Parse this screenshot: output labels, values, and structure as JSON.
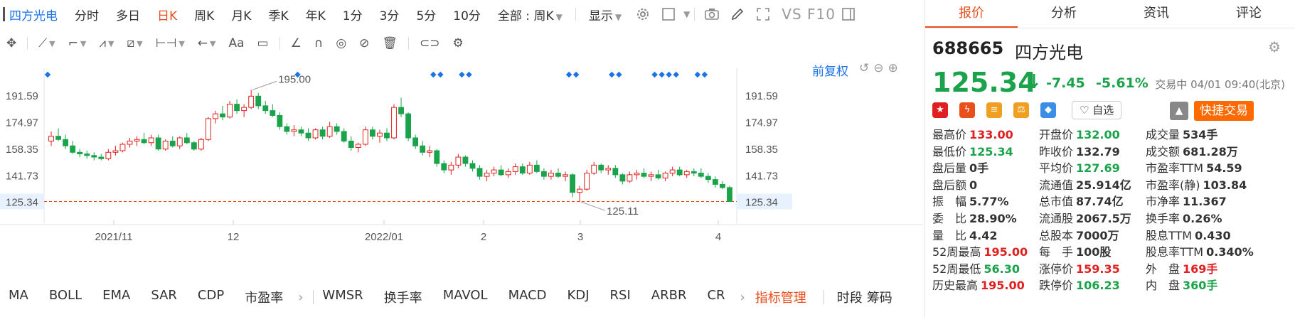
{
  "toolbar": {
    "stock_name": "四方光电",
    "periods": [
      "分时",
      "多日",
      "日K",
      "周K",
      "月K",
      "季K",
      "年K",
      "1分",
      "3分",
      "5分",
      "10分"
    ],
    "active_period": "日K",
    "range_selector": "全部 : 周K",
    "display_label": "显示",
    "vs_label": "VS",
    "f10_label": "F10"
  },
  "drawing_tools": {
    "text_tool": "Aa"
  },
  "chart_controls": {
    "adjust_label": "前复权"
  },
  "chart_data": {
    "type": "candlestick",
    "title": "",
    "x_tick_labels": [
      "2021/11",
      "12",
      "2022/01",
      "2",
      "3",
      "4"
    ],
    "y_tick_labels": [
      "191.59",
      "174.97",
      "158.35",
      "141.73",
      "125.34"
    ],
    "ylim": [
      118,
      204
    ],
    "current_price_line": 125.34,
    "high_annotation": "195.00",
    "low_annotation": "125.11",
    "ohlc_note": "approximate daily candles, values in CNY",
    "candles": [
      {
        "o": 163,
        "h": 169,
        "l": 160,
        "c": 166
      },
      {
        "o": 166,
        "h": 171,
        "l": 163,
        "c": 164
      },
      {
        "o": 164,
        "h": 167,
        "l": 158,
        "c": 160
      },
      {
        "o": 160,
        "h": 163,
        "l": 155,
        "c": 156
      },
      {
        "o": 156,
        "h": 158,
        "l": 153,
        "c": 155
      },
      {
        "o": 155,
        "h": 157,
        "l": 152,
        "c": 154
      },
      {
        "o": 154,
        "h": 156,
        "l": 151,
        "c": 153
      },
      {
        "o": 153,
        "h": 155,
        "l": 151,
        "c": 152
      },
      {
        "o": 152,
        "h": 158,
        "l": 151,
        "c": 156
      },
      {
        "o": 156,
        "h": 160,
        "l": 154,
        "c": 157
      },
      {
        "o": 157,
        "h": 162,
        "l": 156,
        "c": 161
      },
      {
        "o": 161,
        "h": 165,
        "l": 159,
        "c": 163
      },
      {
        "o": 163,
        "h": 166,
        "l": 160,
        "c": 164
      },
      {
        "o": 164,
        "h": 168,
        "l": 161,
        "c": 162
      },
      {
        "o": 162,
        "h": 167,
        "l": 160,
        "c": 165
      },
      {
        "o": 165,
        "h": 167,
        "l": 157,
        "c": 158
      },
      {
        "o": 158,
        "h": 164,
        "l": 157,
        "c": 163
      },
      {
        "o": 163,
        "h": 166,
        "l": 159,
        "c": 160
      },
      {
        "o": 160,
        "h": 166,
        "l": 158,
        "c": 165
      },
      {
        "o": 165,
        "h": 168,
        "l": 161,
        "c": 162
      },
      {
        "o": 162,
        "h": 163,
        "l": 157,
        "c": 158
      },
      {
        "o": 158,
        "h": 165,
        "l": 157,
        "c": 164
      },
      {
        "o": 164,
        "h": 178,
        "l": 163,
        "c": 177
      },
      {
        "o": 177,
        "h": 182,
        "l": 174,
        "c": 180
      },
      {
        "o": 180,
        "h": 185,
        "l": 176,
        "c": 178
      },
      {
        "o": 178,
        "h": 188,
        "l": 177,
        "c": 186
      },
      {
        "o": 186,
        "h": 189,
        "l": 180,
        "c": 182
      },
      {
        "o": 182,
        "h": 186,
        "l": 178,
        "c": 184
      },
      {
        "o": 184,
        "h": 195,
        "l": 183,
        "c": 191
      },
      {
        "o": 191,
        "h": 193,
        "l": 183,
        "c": 185
      },
      {
        "o": 185,
        "h": 188,
        "l": 180,
        "c": 182
      },
      {
        "o": 182,
        "h": 186,
        "l": 178,
        "c": 179
      },
      {
        "o": 179,
        "h": 181,
        "l": 170,
        "c": 172
      },
      {
        "o": 172,
        "h": 174,
        "l": 167,
        "c": 169
      },
      {
        "o": 169,
        "h": 173,
        "l": 166,
        "c": 170
      },
      {
        "o": 170,
        "h": 172,
        "l": 166,
        "c": 168
      },
      {
        "o": 168,
        "h": 171,
        "l": 163,
        "c": 165
      },
      {
        "o": 165,
        "h": 171,
        "l": 164,
        "c": 170
      },
      {
        "o": 170,
        "h": 172,
        "l": 164,
        "c": 166
      },
      {
        "o": 166,
        "h": 175,
        "l": 165,
        "c": 172
      },
      {
        "o": 172,
        "h": 174,
        "l": 167,
        "c": 169
      },
      {
        "o": 169,
        "h": 171,
        "l": 162,
        "c": 163
      },
      {
        "o": 163,
        "h": 166,
        "l": 157,
        "c": 159
      },
      {
        "o": 159,
        "h": 162,
        "l": 156,
        "c": 161
      },
      {
        "o": 161,
        "h": 172,
        "l": 160,
        "c": 170
      },
      {
        "o": 170,
        "h": 172,
        "l": 164,
        "c": 166
      },
      {
        "o": 166,
        "h": 170,
        "l": 162,
        "c": 168
      },
      {
        "o": 168,
        "h": 171,
        "l": 163,
        "c": 165
      },
      {
        "o": 165,
        "h": 186,
        "l": 164,
        "c": 184
      },
      {
        "o": 184,
        "h": 190,
        "l": 178,
        "c": 180
      },
      {
        "o": 180,
        "h": 181,
        "l": 163,
        "c": 165
      },
      {
        "o": 165,
        "h": 167,
        "l": 158,
        "c": 160
      },
      {
        "o": 160,
        "h": 163,
        "l": 154,
        "c": 156
      },
      {
        "o": 156,
        "h": 160,
        "l": 153,
        "c": 157
      },
      {
        "o": 157,
        "h": 158,
        "l": 147,
        "c": 149
      },
      {
        "o": 149,
        "h": 151,
        "l": 143,
        "c": 145
      },
      {
        "o": 145,
        "h": 150,
        "l": 142,
        "c": 148
      },
      {
        "o": 148,
        "h": 155,
        "l": 146,
        "c": 153
      },
      {
        "o": 153,
        "h": 154,
        "l": 147,
        "c": 149
      },
      {
        "o": 149,
        "h": 151,
        "l": 144,
        "c": 146
      },
      {
        "o": 146,
        "h": 148,
        "l": 139,
        "c": 141
      },
      {
        "o": 141,
        "h": 145,
        "l": 138,
        "c": 143
      },
      {
        "o": 143,
        "h": 147,
        "l": 141,
        "c": 145
      },
      {
        "o": 145,
        "h": 148,
        "l": 141,
        "c": 142
      },
      {
        "o": 142,
        "h": 146,
        "l": 140,
        "c": 144
      },
      {
        "o": 144,
        "h": 149,
        "l": 142,
        "c": 147
      },
      {
        "o": 147,
        "h": 149,
        "l": 142,
        "c": 143
      },
      {
        "o": 143,
        "h": 150,
        "l": 142,
        "c": 148
      },
      {
        "o": 148,
        "h": 151,
        "l": 143,
        "c": 144
      },
      {
        "o": 144,
        "h": 146,
        "l": 139,
        "c": 141
      },
      {
        "o": 141,
        "h": 145,
        "l": 139,
        "c": 143
      },
      {
        "o": 143,
        "h": 146,
        "l": 140,
        "c": 141
      },
      {
        "o": 141,
        "h": 144,
        "l": 138,
        "c": 142
      },
      {
        "o": 142,
        "h": 143,
        "l": 128,
        "c": 131
      },
      {
        "o": 131,
        "h": 135,
        "l": 125,
        "c": 133
      },
      {
        "o": 133,
        "h": 145,
        "l": 132,
        "c": 143
      },
      {
        "o": 143,
        "h": 150,
        "l": 142,
        "c": 148
      },
      {
        "o": 148,
        "h": 149,
        "l": 143,
        "c": 145
      },
      {
        "o": 145,
        "h": 148,
        "l": 142,
        "c": 146
      },
      {
        "o": 146,
        "h": 148,
        "l": 140,
        "c": 142
      },
      {
        "o": 142,
        "h": 143,
        "l": 136,
        "c": 138
      },
      {
        "o": 138,
        "h": 144,
        "l": 137,
        "c": 142
      },
      {
        "o": 142,
        "h": 145,
        "l": 139,
        "c": 143
      },
      {
        "o": 143,
        "h": 146,
        "l": 140,
        "c": 141
      },
      {
        "o": 141,
        "h": 144,
        "l": 138,
        "c": 142
      },
      {
        "o": 142,
        "h": 145,
        "l": 139,
        "c": 140
      },
      {
        "o": 140,
        "h": 144,
        "l": 138,
        "c": 143
      },
      {
        "o": 143,
        "h": 147,
        "l": 141,
        "c": 145
      },
      {
        "o": 145,
        "h": 147,
        "l": 141,
        "c": 142
      },
      {
        "o": 142,
        "h": 145,
        "l": 140,
        "c": 144
      },
      {
        "o": 144,
        "h": 146,
        "l": 141,
        "c": 143
      },
      {
        "o": 143,
        "h": 146,
        "l": 140,
        "c": 141
      },
      {
        "o": 141,
        "h": 143,
        "l": 137,
        "c": 139
      },
      {
        "o": 139,
        "h": 141,
        "l": 134,
        "c": 136
      },
      {
        "o": 136,
        "h": 138,
        "l": 133,
        "c": 134
      },
      {
        "o": 134,
        "h": 135,
        "l": 125,
        "c": 125.34
      }
    ],
    "markers_note": "blue diamond event markers along top"
  },
  "indicators": {
    "group1": [
      "MA",
      "BOLL",
      "EMA",
      "SAR",
      "CDP",
      "市盈率"
    ],
    "group2": [
      "WMSR",
      "换手率",
      "MAVOL",
      "MACD",
      "KDJ",
      "RSI",
      "ARBR",
      "CR"
    ],
    "manager": "指标管理",
    "tail1": "时段",
    "tail2": "筹码"
  },
  "quote": {
    "tabs": [
      "报价",
      "分析",
      "资讯",
      "评论"
    ],
    "code": "688665",
    "name": "四方光电",
    "price": "125.34",
    "change": "-7.45",
    "pct": "-5.61%",
    "time": "交易中 04/01 09:40(北京)",
    "watchlist_label": "自选",
    "quick_trade_label": "快捷交易",
    "colors": {
      "up": "#e02020",
      "down": "#1aa34a",
      "accent": "#e94e1b",
      "link": "#1a73e8"
    },
    "grid": [
      [
        {
          "l": "最高价",
          "v": "133.00",
          "s": "up"
        },
        {
          "l": "开盘价",
          "v": "132.00",
          "s": "down"
        },
        {
          "l": "成交量",
          "v": "534手",
          "s": ""
        }
      ],
      [
        {
          "l": "最低价",
          "v": "125.34",
          "s": "down"
        },
        {
          "l": "昨收价",
          "v": "132.79",
          "s": ""
        },
        {
          "l": "成交额",
          "v": "681.28万",
          "s": ""
        }
      ],
      [
        {
          "l": "盘后量",
          "v": "0手",
          "s": ""
        },
        {
          "l": "平均价",
          "v": "127.69",
          "s": "down"
        },
        {
          "l": "市盈率TTM",
          "v": "54.59",
          "s": ""
        }
      ],
      [
        {
          "l": "盘后额",
          "v": "0",
          "s": ""
        },
        {
          "l": "流通值",
          "v": "25.914亿",
          "s": ""
        },
        {
          "l": "市盈率(静)",
          "v": "103.84",
          "s": ""
        }
      ],
      [
        {
          "l": "振　幅",
          "v": "5.77%",
          "s": ""
        },
        {
          "l": "总市值",
          "v": "87.74亿",
          "s": ""
        },
        {
          "l": "市净率",
          "v": "11.367",
          "s": ""
        }
      ],
      [
        {
          "l": "委　比",
          "v": "28.90%",
          "s": ""
        },
        {
          "l": "流通股",
          "v": "2067.5万",
          "s": ""
        },
        {
          "l": "换手率",
          "v": "0.26%",
          "s": ""
        }
      ],
      [
        {
          "l": "量　比",
          "v": "4.42",
          "s": ""
        },
        {
          "l": "总股本",
          "v": "7000万",
          "s": ""
        },
        {
          "l": "股息TTM",
          "v": "0.430",
          "s": ""
        }
      ],
      [
        {
          "l": "52周最高",
          "v": "195.00",
          "s": "up"
        },
        {
          "l": "每　手",
          "v": "100股",
          "s": ""
        },
        {
          "l": "股息率TTM",
          "v": "0.340%",
          "s": ""
        }
      ],
      [
        {
          "l": "52周最低",
          "v": "56.30",
          "s": "down"
        },
        {
          "l": "涨停价",
          "v": "159.35",
          "s": "up"
        },
        {
          "l": "外　盘",
          "v": "169手",
          "s": "up"
        }
      ],
      [
        {
          "l": "历史最高",
          "v": "195.00",
          "s": "up"
        },
        {
          "l": "跌停价",
          "v": "106.23",
          "s": "down"
        },
        {
          "l": "内　盘",
          "v": "360手",
          "s": "down"
        }
      ]
    ]
  }
}
